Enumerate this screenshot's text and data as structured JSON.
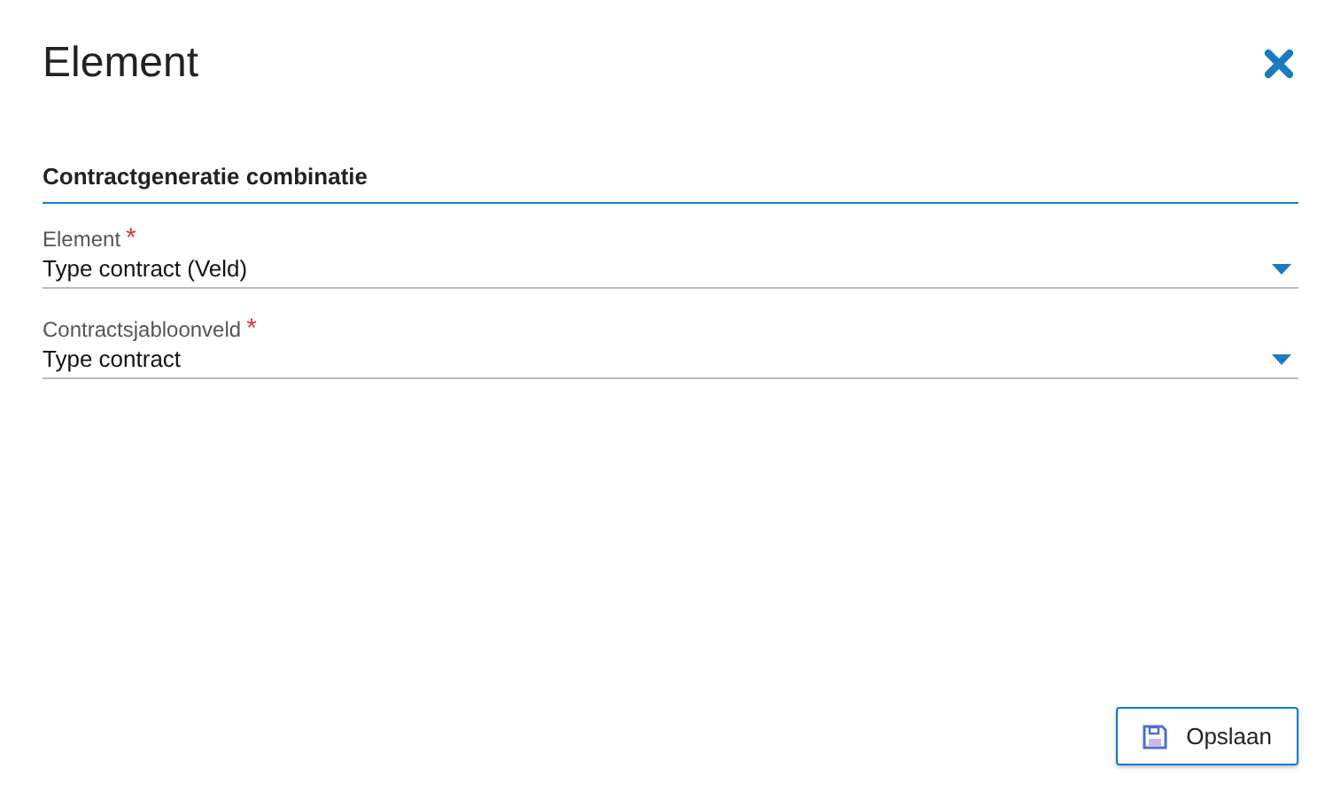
{
  "dialog": {
    "title": "Element"
  },
  "section": {
    "title": "Contractgeneratie combinatie"
  },
  "fields": [
    {
      "label": "Element",
      "required_mark": "*",
      "value": "Type contract (Veld)"
    },
    {
      "label": "Contractsjabloonveld",
      "required_mark": "*",
      "value": "Type contract"
    }
  ],
  "buttons": [
    {
      "label": "Opslaan"
    }
  ]
}
